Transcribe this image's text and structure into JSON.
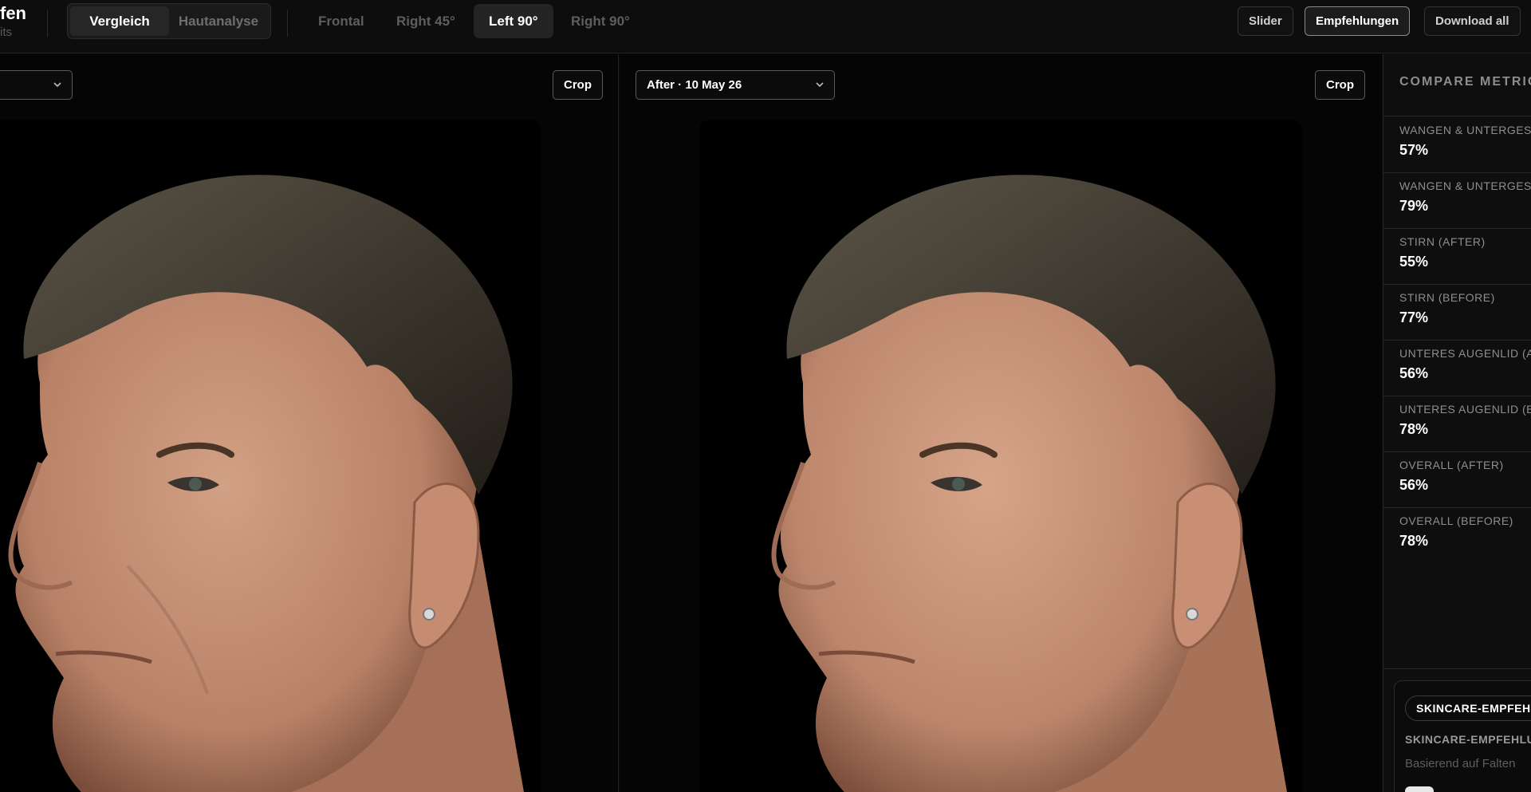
{
  "header": {
    "title": "fen",
    "subtitle": "its",
    "mode_tabs": [
      {
        "label": "Vergleich",
        "active": true
      },
      {
        "label": "Hautanalyse",
        "active": false
      }
    ],
    "angle_tabs": [
      {
        "label": "Frontal",
        "active": false
      },
      {
        "label": "Right 45°",
        "active": false
      },
      {
        "label": "Left 90°",
        "active": true
      },
      {
        "label": "Right 90°",
        "active": false
      }
    ],
    "actions": {
      "slider": "Slider",
      "recommendations": "Empfehlungen",
      "download": "Download all"
    }
  },
  "left_panel": {
    "select_value": "",
    "crop_label": "Crop"
  },
  "right_panel": {
    "select_value": "After · 10 May 26",
    "crop_label": "Crop"
  },
  "sidebar": {
    "title": "COMPARE METRICS",
    "metrics": [
      {
        "label": "WANGEN & UNTERGESICHT (AFTER)",
        "value": "57%"
      },
      {
        "label": "WANGEN & UNTERGESICHT (BEFORE)",
        "value": "79%"
      },
      {
        "label": "STIRN (AFTER)",
        "value": "55%"
      },
      {
        "label": "STIRN (BEFORE)",
        "value": "77%"
      },
      {
        "label": "UNTERES AUGENLID (AFTER)",
        "value": "56%"
      },
      {
        "label": "UNTERES AUGENLID (BEFORE)",
        "value": "78%"
      },
      {
        "label": "OVERALL (AFTER)",
        "value": "56%"
      },
      {
        "label": "OVERALL (BEFORE)",
        "value": "78%"
      }
    ],
    "recommendation": {
      "pill": "SKINCARE-EMPFEHLUNGEN",
      "heading": "SKINCARE-EMPFEHLUNGEN",
      "sub": "Basierend auf Falten"
    }
  },
  "colors": {
    "background": "#0a0a0a",
    "panel": "#050505",
    "accent_border": "#8a8a8a",
    "skin": "#c9937a",
    "hair": "#3b352c"
  }
}
